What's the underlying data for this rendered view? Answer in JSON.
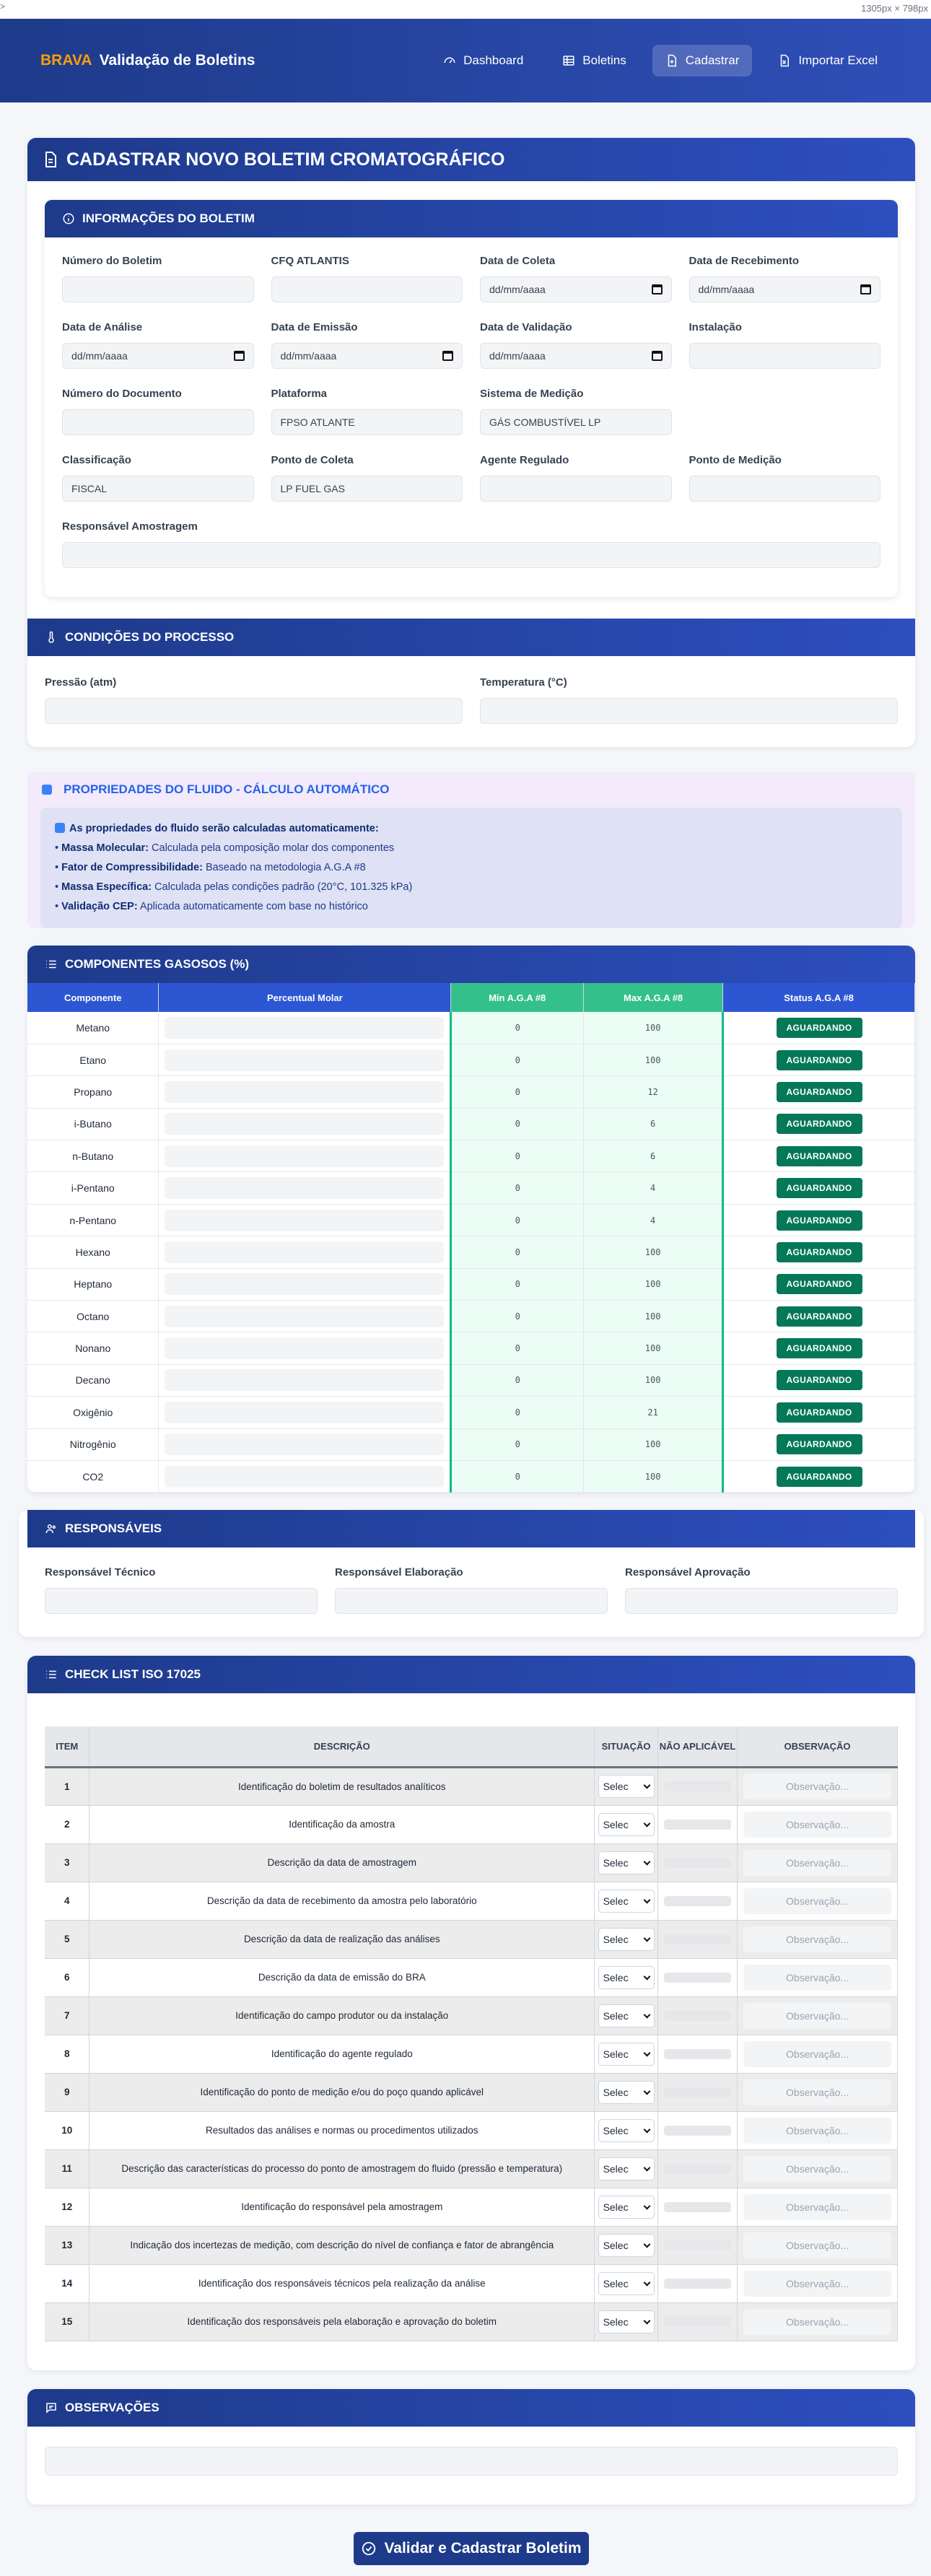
{
  "window": {
    "top_left": ">",
    "dimension_label": "1305px × 798px"
  },
  "navbar": {
    "brand_highlight": "BRAVA",
    "brand_title": "Validação de Boletins",
    "items": [
      {
        "label": "Dashboard",
        "icon": "dashboard-icon",
        "active": false
      },
      {
        "label": "Boletins",
        "icon": "table-icon",
        "active": false
      },
      {
        "label": "Cadastrar",
        "icon": "file-plus-icon",
        "active": true
      },
      {
        "label": "Importar Excel",
        "icon": "file-excel-icon",
        "active": false
      }
    ]
  },
  "page": {
    "title": "CADASTRAR NOVO BOLETIM CROMATOGRÁFICO"
  },
  "info": {
    "title": "INFORMAÇÕES DO BOLETIM",
    "fields": [
      {
        "label": "Número do Boletim",
        "value": ""
      },
      {
        "label": "CFQ ATLANTIS",
        "value": ""
      },
      {
        "label": "Data de Coleta",
        "value": "dd/mm/aaaa"
      },
      {
        "label": "Data de Recebimento",
        "value": "dd/mm/aaaa"
      },
      {
        "label": "Data de Análise",
        "value": "dd/mm/aaaa"
      },
      {
        "label": "Data de Emissão",
        "value": "dd/mm/aaaa"
      },
      {
        "label": "Data de Validação",
        "value": "dd/mm/aaaa"
      },
      {
        "label": "Instalação",
        "value": ""
      },
      {
        "label": "Número do Documento",
        "value": ""
      },
      {
        "label": "Plataforma",
        "value": "FPSO ATLANTE"
      },
      {
        "label": "Sistema de Medição",
        "value": "GÁS COMBUSTÍVEL LP"
      },
      {
        "label": "",
        "value": ""
      },
      {
        "label": "Classificação",
        "value": "FISCAL"
      },
      {
        "label": "Ponto de Coleta",
        "value": "LP FUEL GAS"
      },
      {
        "label": "Agente Regulado",
        "value": ""
      },
      {
        "label": "Ponto de Medição",
        "value": ""
      }
    ],
    "responsavel_label": "Responsável Amostragem",
    "responsavel_value": ""
  },
  "process": {
    "title": "CONDIÇÕES DO PROCESSO",
    "pressure_label": "Pressão (atm)",
    "temperature_label": "Temperatura (°C)"
  },
  "fluid": {
    "title": "PROPRIEDADES DO FLUIDO - CÁLCULO AUTOMÁTICO",
    "note": "As propriedades do fluido serão calculadas automaticamente:",
    "items": [
      {
        "name": "Massa Molecular:",
        "desc": "Calculada pela composição molar dos componentes"
      },
      {
        "name": "Fator de Compressibilidade:",
        "desc": "Baseado na metodologia A.G.A #8"
      },
      {
        "name": "Massa Específica:",
        "desc": "Calculada pelas condições padrão (20°C, 101.325 kPa)"
      },
      {
        "name": "Validação CEP:",
        "desc": "Aplicada automaticamente com base no histórico"
      }
    ]
  },
  "components": {
    "title": "COMPONENTES GASOSOS (%)",
    "headers": [
      "Componente",
      "Percentual Molar",
      "Min A.G.A #8",
      "Max A.G.A #8",
      "Status A.G.A #8"
    ],
    "rows": [
      {
        "name": "Metano",
        "min": "0",
        "max": "100",
        "status": "AGUARDANDO"
      },
      {
        "name": "Etano",
        "min": "0",
        "max": "100",
        "status": "AGUARDANDO"
      },
      {
        "name": "Propano",
        "min": "0",
        "max": "12",
        "status": "AGUARDANDO"
      },
      {
        "name": "i-Butano",
        "min": "0",
        "max": "6",
        "status": "AGUARDANDO"
      },
      {
        "name": "n-Butano",
        "min": "0",
        "max": "6",
        "status": "AGUARDANDO"
      },
      {
        "name": "i-Pentano",
        "min": "0",
        "max": "4",
        "status": "AGUARDANDO"
      },
      {
        "name": "n-Pentano",
        "min": "0",
        "max": "4",
        "status": "AGUARDANDO"
      },
      {
        "name": "Hexano",
        "min": "0",
        "max": "100",
        "status": "AGUARDANDO"
      },
      {
        "name": "Heptano",
        "min": "0",
        "max": "100",
        "status": "AGUARDANDO"
      },
      {
        "name": "Octano",
        "min": "0",
        "max": "100",
        "status": "AGUARDANDO"
      },
      {
        "name": "Nonano",
        "min": "0",
        "max": "100",
        "status": "AGUARDANDO"
      },
      {
        "name": "Decano",
        "min": "0",
        "max": "100",
        "status": "AGUARDANDO"
      },
      {
        "name": "Oxigênio",
        "min": "0",
        "max": "21",
        "status": "AGUARDANDO"
      },
      {
        "name": "Nitrogênio",
        "min": "0",
        "max": "100",
        "status": "AGUARDANDO"
      },
      {
        "name": "CO2",
        "min": "0",
        "max": "100",
        "status": "AGUARDANDO"
      }
    ]
  },
  "responsaveis": {
    "title": "RESPONSÁVEIS",
    "labels": [
      "Responsável Técnico",
      "Responsável Elaboração",
      "Responsável Aprovação"
    ]
  },
  "checklist": {
    "title": "CHECK LIST ISO 17025",
    "headers": [
      "ITEM",
      "DESCRIÇÃO",
      "SITUAÇÃO",
      "NÃO APLICÁVEL",
      "OBSERVAÇÃO"
    ],
    "select_value": "Selec",
    "obs_placeholder": "Observação...",
    "rows": [
      {
        "item": "1",
        "desc": "Identificação do boletim de resultados analíticos"
      },
      {
        "item": "2",
        "desc": "Identificação da amostra"
      },
      {
        "item": "3",
        "desc": "Descrição da data de amostragem"
      },
      {
        "item": "4",
        "desc": "Descrição da data de recebimento da amostra pelo laboratório"
      },
      {
        "item": "5",
        "desc": "Descrição da data de realização das análises"
      },
      {
        "item": "6",
        "desc": "Descrição da data de emissão do BRA"
      },
      {
        "item": "7",
        "desc": "Identificação do campo produtor ou da instalação"
      },
      {
        "item": "8",
        "desc": "Identificação do agente regulado"
      },
      {
        "item": "9",
        "desc": "Identificação do ponto de medição e/ou do poço quando aplicável"
      },
      {
        "item": "10",
        "desc": "Resultados das análises e normas ou procedimentos utilizados"
      },
      {
        "item": "11",
        "desc": "Descrição das características do processo do ponto de amostragem do fluido (pressão e temperatura)"
      },
      {
        "item": "12",
        "desc": "Identificação do responsável pela amostragem"
      },
      {
        "item": "13",
        "desc": "Indicação dos incertezas de medição, com descrição do nível de confiança e fator de abrangência"
      },
      {
        "item": "14",
        "desc": "Identificação dos responsáveis técnicos pela realização da análise"
      },
      {
        "item": "15",
        "desc": "Identificação dos responsáveis pela elaboração e aprovação do boletim"
      }
    ]
  },
  "observacoes": {
    "title": "OBSERVAÇÕES"
  },
  "submit": {
    "label": "Validar e Cadastrar Boletim"
  }
}
